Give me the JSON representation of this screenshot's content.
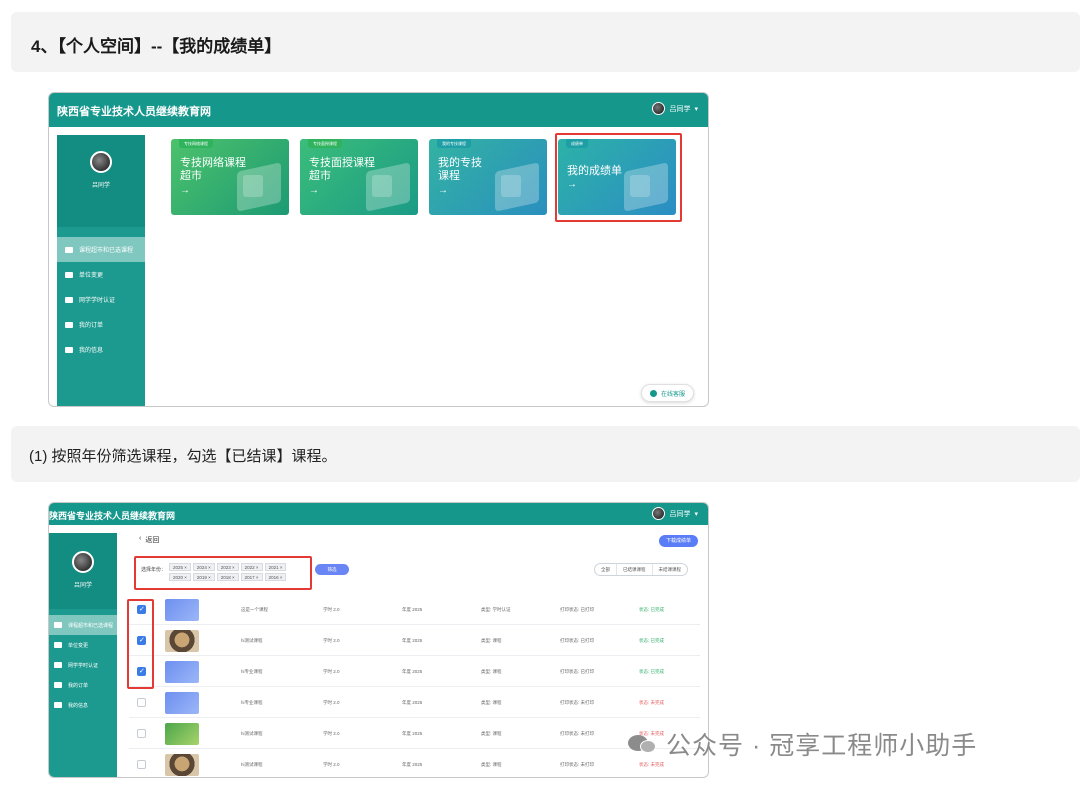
{
  "step_heading": "4、【个人空间】--【我的成绩单】",
  "instruction": "(1) 按照年份筛选课程，勾选【已结课】课程。",
  "portal": {
    "site_name": "陕西省专业技术人员继续教育网",
    "user_name": "吕同学",
    "sidebar": [
      {
        "label": "课程超市和已选课程",
        "active": true
      },
      {
        "label": "单位变更",
        "active": false
      },
      {
        "label": "网学学时认证",
        "active": false
      },
      {
        "label": "我的订单",
        "active": false
      },
      {
        "label": "我的信息",
        "active": false
      }
    ],
    "cards": [
      {
        "tag": "专技网络课程",
        "title": "专技网络课程超市",
        "arrow": "→"
      },
      {
        "tag": "专技面授课程",
        "title": "专技面授课程超市",
        "arrow": "→"
      },
      {
        "tag": "我的专技课程",
        "title": "我的专技课程",
        "arrow": "→"
      },
      {
        "tag": "成绩单",
        "title": "我的成绩单",
        "arrow": "→"
      }
    ],
    "online_service": "在线客服"
  },
  "transcript": {
    "site_name": "陕西省专业技术人员继续教育网",
    "user_name": "吕同学",
    "back_label": "返回",
    "download_label": "下载成绩单",
    "filter_label": "选择年份：",
    "year_chips": [
      "2025 ×",
      "2024 ×",
      "2023 ×",
      "2022 ×",
      "2021 ×",
      "2020 ×",
      "2019 ×",
      "2018 ×",
      "2017 ×",
      "2016 ×"
    ],
    "filter_button": "筛选",
    "segments": [
      "全部",
      "已结课课程",
      "未结课课程"
    ],
    "sidebar": [
      {
        "label": "课程超市和已选课程",
        "active": true
      },
      {
        "label": "单位变更",
        "active": false
      },
      {
        "label": "网学学时认证",
        "active": false
      },
      {
        "label": "我的订单",
        "active": false
      },
      {
        "label": "我的信息",
        "active": false
      }
    ],
    "rows": [
      {
        "checked": true,
        "thumb": "blue",
        "name": "这是一个课程",
        "hours": "学时 2.0",
        "year": "年度 2025",
        "type": "类型: 学时认证",
        "print": "打印状态: 已打印",
        "status": "状态: 已完成",
        "done": true
      },
      {
        "checked": true,
        "thumb": "dog",
        "name": "hi测试课程",
        "hours": "学时 2.0",
        "year": "年度 2025",
        "type": "类型: 课程",
        "print": "打印状态: 已打印",
        "status": "状态: 已完成",
        "done": true
      },
      {
        "checked": true,
        "thumb": "blue",
        "name": "hi专业课程",
        "hours": "学时 2.0",
        "year": "年度 2025",
        "type": "类型: 课程",
        "print": "打印状态: 已打印",
        "status": "状态: 已完成",
        "done": true
      },
      {
        "checked": false,
        "thumb": "blue",
        "name": "hi专业课程",
        "hours": "学时 2.0",
        "year": "年度 2025",
        "type": "类型: 课程",
        "print": "打印状态: 未打印",
        "status": "状态: 未完成",
        "done": false
      },
      {
        "checked": false,
        "thumb": "green",
        "name": "hi测试课程",
        "hours": "学时 2.0",
        "year": "年度 2025",
        "type": "类型: 课程",
        "print": "打印状态: 未打印",
        "status": "状态: 未完成",
        "done": false
      },
      {
        "checked": false,
        "thumb": "dog",
        "name": "hi测试课程",
        "hours": "学时 2.0",
        "year": "年度 2025",
        "type": "类型: 课程",
        "print": "打印状态: 未打印",
        "status": "状态: 未完成",
        "done": false
      }
    ]
  },
  "watermark": "公众号 · 冠享工程师小助手",
  "colors": {
    "brand": "#16978c",
    "highlight": "#e53935",
    "accent": "#5b7cf7"
  }
}
